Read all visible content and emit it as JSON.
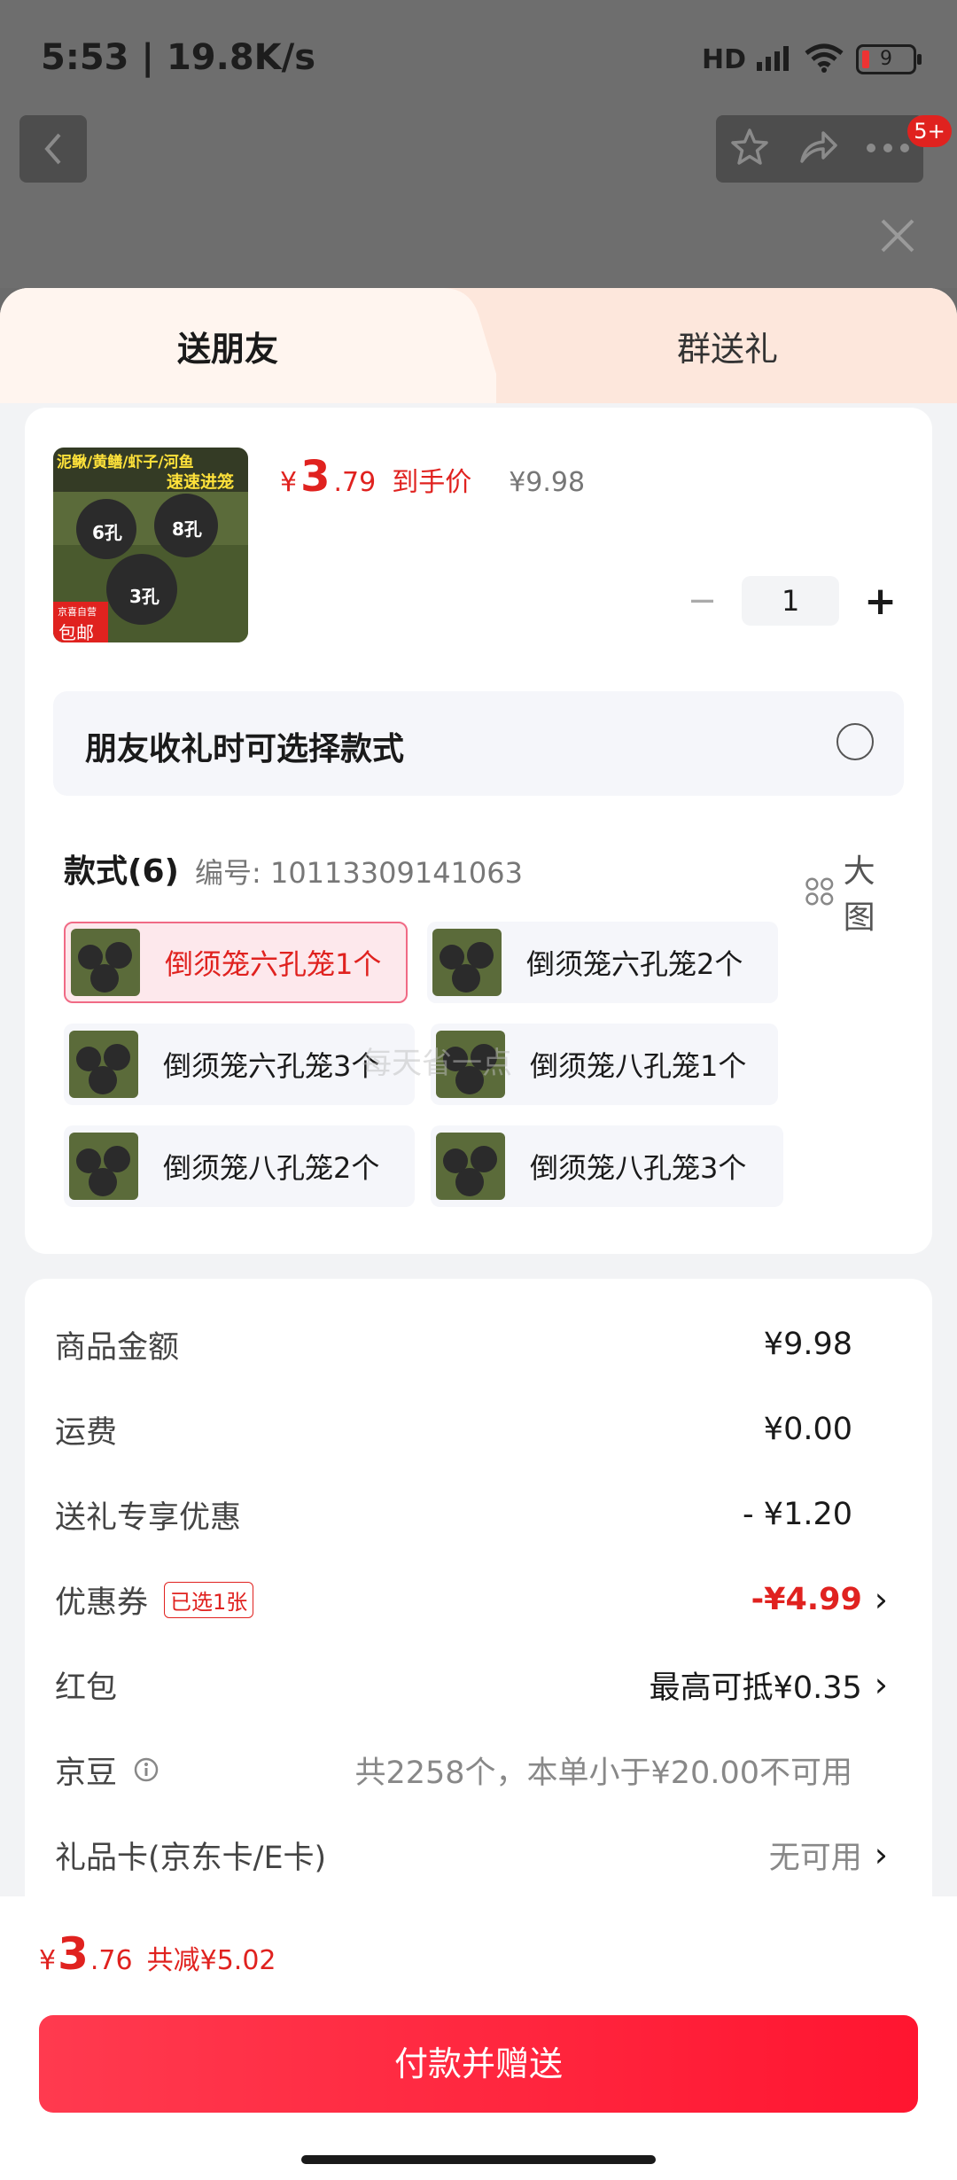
{
  "status": {
    "time": "5:53 | 19.8K/s",
    "signal": "HD",
    "battery": "9"
  },
  "header": {
    "badge": "5+"
  },
  "tabs": [
    {
      "label": "送朋友"
    },
    {
      "label": "群送礼"
    }
  ],
  "product": {
    "thumb_caption_top": "泥鳅/黄鳝/虾子/河鱼",
    "thumb_caption_mid": "速速进笼",
    "thumb_labels": [
      "6孔",
      "8孔",
      "3孔"
    ],
    "thumb_tag_1": "京喜自营",
    "thumb_tag_2": "包邮",
    "price_symbol": "¥",
    "price_int": "3",
    "price_dec": ".79",
    "price_label": "到手价",
    "original_price": "¥9.98",
    "qty_minus": "−",
    "qty": "1",
    "qty_plus": "+"
  },
  "choose": {
    "label": "朋友收礼时可选择款式"
  },
  "specs": {
    "title": "款式(6)",
    "code": "编号: 10113309141063",
    "big_view": "大图",
    "watermark": "每天省一点",
    "items": [
      {
        "label": "倒须笼六孔笼1个"
      },
      {
        "label": "倒须笼六孔笼2个"
      },
      {
        "label": "倒须笼六孔笼3个"
      },
      {
        "label": "倒须笼八孔笼1个"
      },
      {
        "label": "倒须笼八孔笼2个"
      },
      {
        "label": "倒须笼八孔笼3个"
      }
    ]
  },
  "summary": {
    "rows": [
      {
        "label": "商品金额",
        "value": "¥9.98"
      },
      {
        "label": "运费",
        "value": "¥0.00"
      },
      {
        "label": "送礼专享优惠",
        "value": "- ¥1.20"
      },
      {
        "label": "优惠券",
        "tag": "已选1张",
        "value": "-¥4.99"
      },
      {
        "label": "红包",
        "value": "最高可抵¥0.35"
      },
      {
        "label": "京豆",
        "value": "共2258个，本单小于¥20.00不可用"
      },
      {
        "label": "礼品卡(京东卡/E卡)",
        "value": "无可用"
      }
    ]
  },
  "footer": {
    "total_symbol": "¥",
    "total_int": "3",
    "total_dec": ".76",
    "discount": "共减¥5.02",
    "pay_button": "付款并赠送"
  },
  "colors": {
    "accent": "#e0221f",
    "button": "#ff1f3a",
    "tab_bg": "#fde7dc"
  }
}
